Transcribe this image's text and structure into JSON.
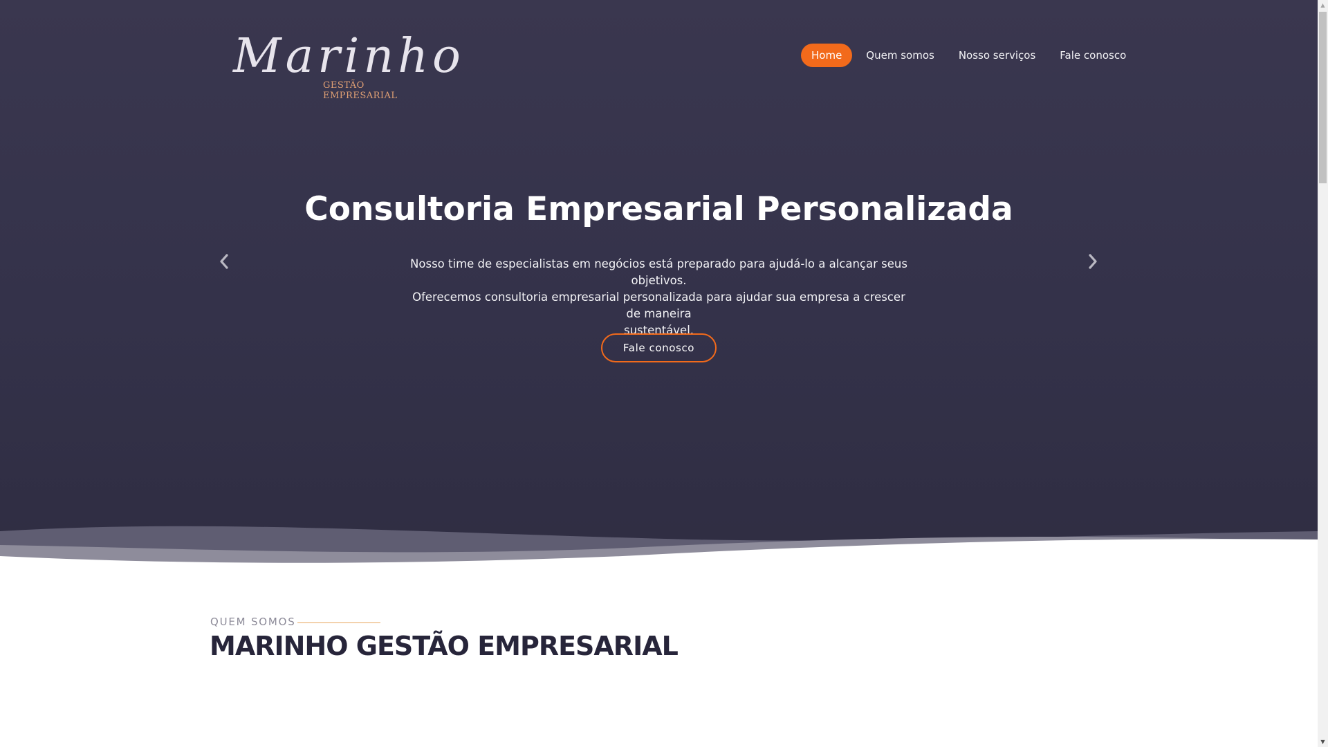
{
  "header": {
    "logo_script": "Marinho",
    "logo_subtitle": "GESTÃO EMPRESARIAL",
    "nav": [
      {
        "label": "Home",
        "active": true
      },
      {
        "label": "Quem somos",
        "active": false
      },
      {
        "label": "Nosso serviços",
        "active": false
      },
      {
        "label": "Fale conosco",
        "active": false
      }
    ]
  },
  "hero": {
    "title": "Consultoria Empresarial Personalizada",
    "text_line1": "Nosso time de especialistas em negócios está preparado para ajudá-lo a alcançar seus objetivos.",
    "text_line2": "Oferecemos consultoria empresarial personalizada para ajudar sua empresa a crescer de maneira",
    "text_line3": "sustentável.",
    "cta_label": "Fale conosco",
    "prev_icon": "chevron-left-icon",
    "next_icon": "chevron-right-icon"
  },
  "about": {
    "label": "QUEM SOMOS",
    "title": "MARINHO GESTÃO EMPRESARIAL"
  },
  "colors": {
    "accent": "#f26a1b",
    "hero_bg": "#37344c",
    "heading_dark": "#27253a",
    "label_gold": "#e6a45a"
  }
}
